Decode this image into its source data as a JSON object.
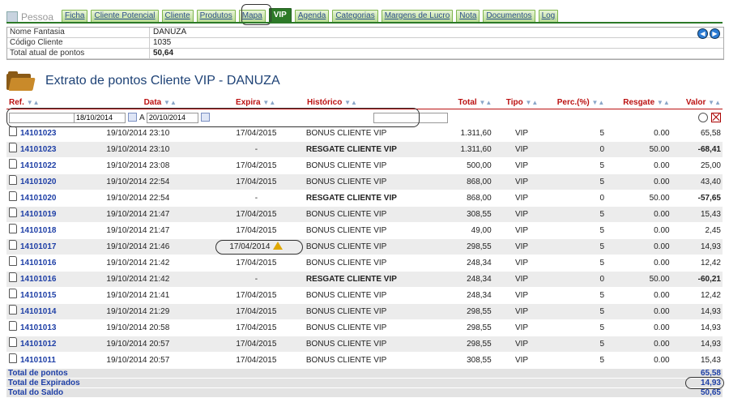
{
  "tabs": {
    "person": "Pessoa",
    "items": [
      "Ficha",
      "Cliente Potencial",
      "Cliente",
      "Produtos",
      "Mapa",
      "VIP",
      "Agenda",
      "Categorias",
      "Margens de Lucro",
      "Nota",
      "Documentos",
      "Log"
    ],
    "active": "VIP"
  },
  "info": [
    {
      "label": "Nome Fantasia",
      "value": "DANUZA"
    },
    {
      "label": "Código Cliente",
      "value": "1035"
    },
    {
      "label": "Total atual de pontos",
      "value": "50,64"
    }
  ],
  "title": "Extrato de pontos Cliente VIP - DANUZA",
  "columns": [
    "Ref.",
    "Data",
    "Expira",
    "Histórico",
    "Total",
    "Tipo",
    "Perc.(%)",
    "Resgate",
    "Valor"
  ],
  "sort_icon": "▼▲",
  "filter": {
    "date_from": "18/10/2014",
    "date_sep": "A",
    "date_to": "20/10/2014",
    "ref": "",
    "historico": ""
  },
  "rows": [
    {
      "ref": "14101023",
      "data": "19/10/2014 23:10",
      "expira": "17/04/2015",
      "hist": "BONUS CLIENTE VIP",
      "total": "1.311,60",
      "tipo": "VIP",
      "perc": "5",
      "resgate": "0.00",
      "valor": "65,58"
    },
    {
      "ref": "14101023",
      "data": "19/10/2014 23:10",
      "expira": "-",
      "hist": "RESGATE CLIENTE VIP",
      "total": "1.311,60",
      "tipo": "VIP",
      "perc": "0",
      "resgate": "50.00",
      "valor": "-68,41"
    },
    {
      "ref": "14101022",
      "data": "19/10/2014 23:08",
      "expira": "17/04/2015",
      "hist": "BONUS CLIENTE VIP",
      "total": "500,00",
      "tipo": "VIP",
      "perc": "5",
      "resgate": "0.00",
      "valor": "25,00"
    },
    {
      "ref": "14101020",
      "data": "19/10/2014 22:54",
      "expira": "17/04/2015",
      "hist": "BONUS CLIENTE VIP",
      "total": "868,00",
      "tipo": "VIP",
      "perc": "5",
      "resgate": "0.00",
      "valor": "43,40"
    },
    {
      "ref": "14101020",
      "data": "19/10/2014 22:54",
      "expira": "-",
      "hist": "RESGATE CLIENTE VIP",
      "total": "868,00",
      "tipo": "VIP",
      "perc": "0",
      "resgate": "50.00",
      "valor": "-57,65"
    },
    {
      "ref": "14101019",
      "data": "19/10/2014 21:47",
      "expira": "17/04/2015",
      "hist": "BONUS CLIENTE VIP",
      "total": "308,55",
      "tipo": "VIP",
      "perc": "5",
      "resgate": "0.00",
      "valor": "15,43"
    },
    {
      "ref": "14101018",
      "data": "19/10/2014 21:47",
      "expira": "17/04/2015",
      "hist": "BONUS CLIENTE VIP",
      "total": "49,00",
      "tipo": "VIP",
      "perc": "5",
      "resgate": "0.00",
      "valor": "2,45"
    },
    {
      "ref": "14101017",
      "data": "19/10/2014 21:46",
      "expira": "17/04/2014",
      "hist": "BONUS CLIENTE VIP",
      "total": "298,55",
      "tipo": "VIP",
      "perc": "5",
      "resgate": "0.00",
      "valor": "14,93",
      "expired": true
    },
    {
      "ref": "14101016",
      "data": "19/10/2014 21:42",
      "expira": "17/04/2015",
      "hist": "BONUS CLIENTE VIP",
      "total": "248,34",
      "tipo": "VIP",
      "perc": "5",
      "resgate": "0.00",
      "valor": "12,42"
    },
    {
      "ref": "14101016",
      "data": "19/10/2014 21:42",
      "expira": "-",
      "hist": "RESGATE CLIENTE VIP",
      "total": "248,34",
      "tipo": "VIP",
      "perc": "0",
      "resgate": "50.00",
      "valor": "-60,21"
    },
    {
      "ref": "14101015",
      "data": "19/10/2014 21:41",
      "expira": "17/04/2015",
      "hist": "BONUS CLIENTE VIP",
      "total": "248,34",
      "tipo": "VIP",
      "perc": "5",
      "resgate": "0.00",
      "valor": "12,42"
    },
    {
      "ref": "14101014",
      "data": "19/10/2014 21:29",
      "expira": "17/04/2015",
      "hist": "BONUS CLIENTE VIP",
      "total": "298,55",
      "tipo": "VIP",
      "perc": "5",
      "resgate": "0.00",
      "valor": "14,93"
    },
    {
      "ref": "14101013",
      "data": "19/10/2014 20:58",
      "expira": "17/04/2015",
      "hist": "BONUS CLIENTE VIP",
      "total": "298,55",
      "tipo": "VIP",
      "perc": "5",
      "resgate": "0.00",
      "valor": "14,93"
    },
    {
      "ref": "14101012",
      "data": "19/10/2014 20:57",
      "expira": "17/04/2015",
      "hist": "BONUS CLIENTE VIP",
      "total": "298,55",
      "tipo": "VIP",
      "perc": "5",
      "resgate": "0.00",
      "valor": "14,93"
    },
    {
      "ref": "14101011",
      "data": "19/10/2014 20:57",
      "expira": "17/04/2015",
      "hist": "BONUS CLIENTE VIP",
      "total": "308,55",
      "tipo": "VIP",
      "perc": "5",
      "resgate": "0.00",
      "valor": "15,43"
    }
  ],
  "totals": [
    {
      "label": "Total de pontos",
      "value": "65,58"
    },
    {
      "label": "Total de Expirados",
      "value": "14,93"
    },
    {
      "label": "Total do Saldo",
      "value": "50,65"
    }
  ],
  "colors": {
    "accent": "#2d7a28",
    "link": "#1e3fa6",
    "header": "#b11"
  }
}
